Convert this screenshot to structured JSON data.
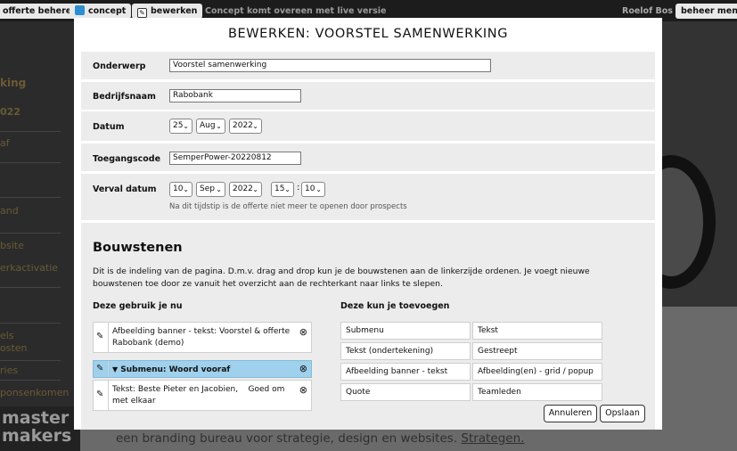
{
  "topbar": {
    "offerte_beheren": "offerte beheren",
    "concept": "concept",
    "bewerken": "bewerken",
    "status_text": "Concept komt overeen met live versie",
    "user_name": "Roelof Bos",
    "beheer_menu": "beheer menu"
  },
  "background": {
    "sidebar_items": [
      "king",
      "022",
      "af",
      "and",
      "bsite",
      "erkactivatie",
      "els",
      "osten",
      "ries",
      "ponsenkomen"
    ],
    "logo_line1": "master",
    "logo_line2": "makers",
    "tagline": "een branding bureau voor strategie, design en websites.",
    "tagline_link": "Strategen."
  },
  "modal": {
    "title": "BEWERKEN: VOORSTEL SAMENWERKING",
    "fields": {
      "onderwerp_label": "Onderwerp",
      "onderwerp_value": "Voorstel samenwerking",
      "bedrijfsnaam_label": "Bedrijfsnaam",
      "bedrijfsnaam_value": "Rabobank",
      "datum_label": "Datum",
      "datum_day": "25",
      "datum_month": "Aug",
      "datum_year": "2022",
      "toegangscode_label": "Toegangscode",
      "toegangscode_value": "SemperPower-20220812",
      "verval_label": "Verval datum",
      "verval_day": "10",
      "verval_month": "Sep",
      "verval_year": "2022",
      "verval_hour": "15",
      "verval_minute": "10",
      "verval_separator": ":",
      "verval_note": "Na dit tijdstip is de offerte niet meer te openen door prospects"
    },
    "bouwstenen": {
      "heading": "Bouwstenen",
      "intro": "Dit is de indeling van de pagina. D.m.v. drag and drop kun je de bouwstenen aan de linkerzijde ordenen. Je voegt nieuwe bouwstenen toe door ze vanuit het overzicht aan de rechterkant naar links te slepen.",
      "used_heading": "Deze gebruik je nu",
      "add_heading": "Deze kun je toevoegen",
      "used_items": [
        "Afbeelding banner - tekst: Voorstel & offerte Rabobank (demo)",
        "Submenu: Woord vooraf",
        "Tekst: Beste Pieter en Jacobien,    Goed om met elkaar"
      ],
      "available_items": [
        "Submenu",
        "Tekst",
        "Tekst (ondertekening)",
        "Gestreept",
        "Afbeelding banner - tekst",
        "Afbeelding(en) - grid / popup",
        "Quote",
        "Teamleden"
      ]
    },
    "cancel_label": "Annuleren",
    "save_label": "Opslaan"
  },
  "colors": {
    "topbar": "#1c1c1c",
    "highlight_row": "#9fd0ec",
    "concept_icon": "#2d8fd0"
  }
}
